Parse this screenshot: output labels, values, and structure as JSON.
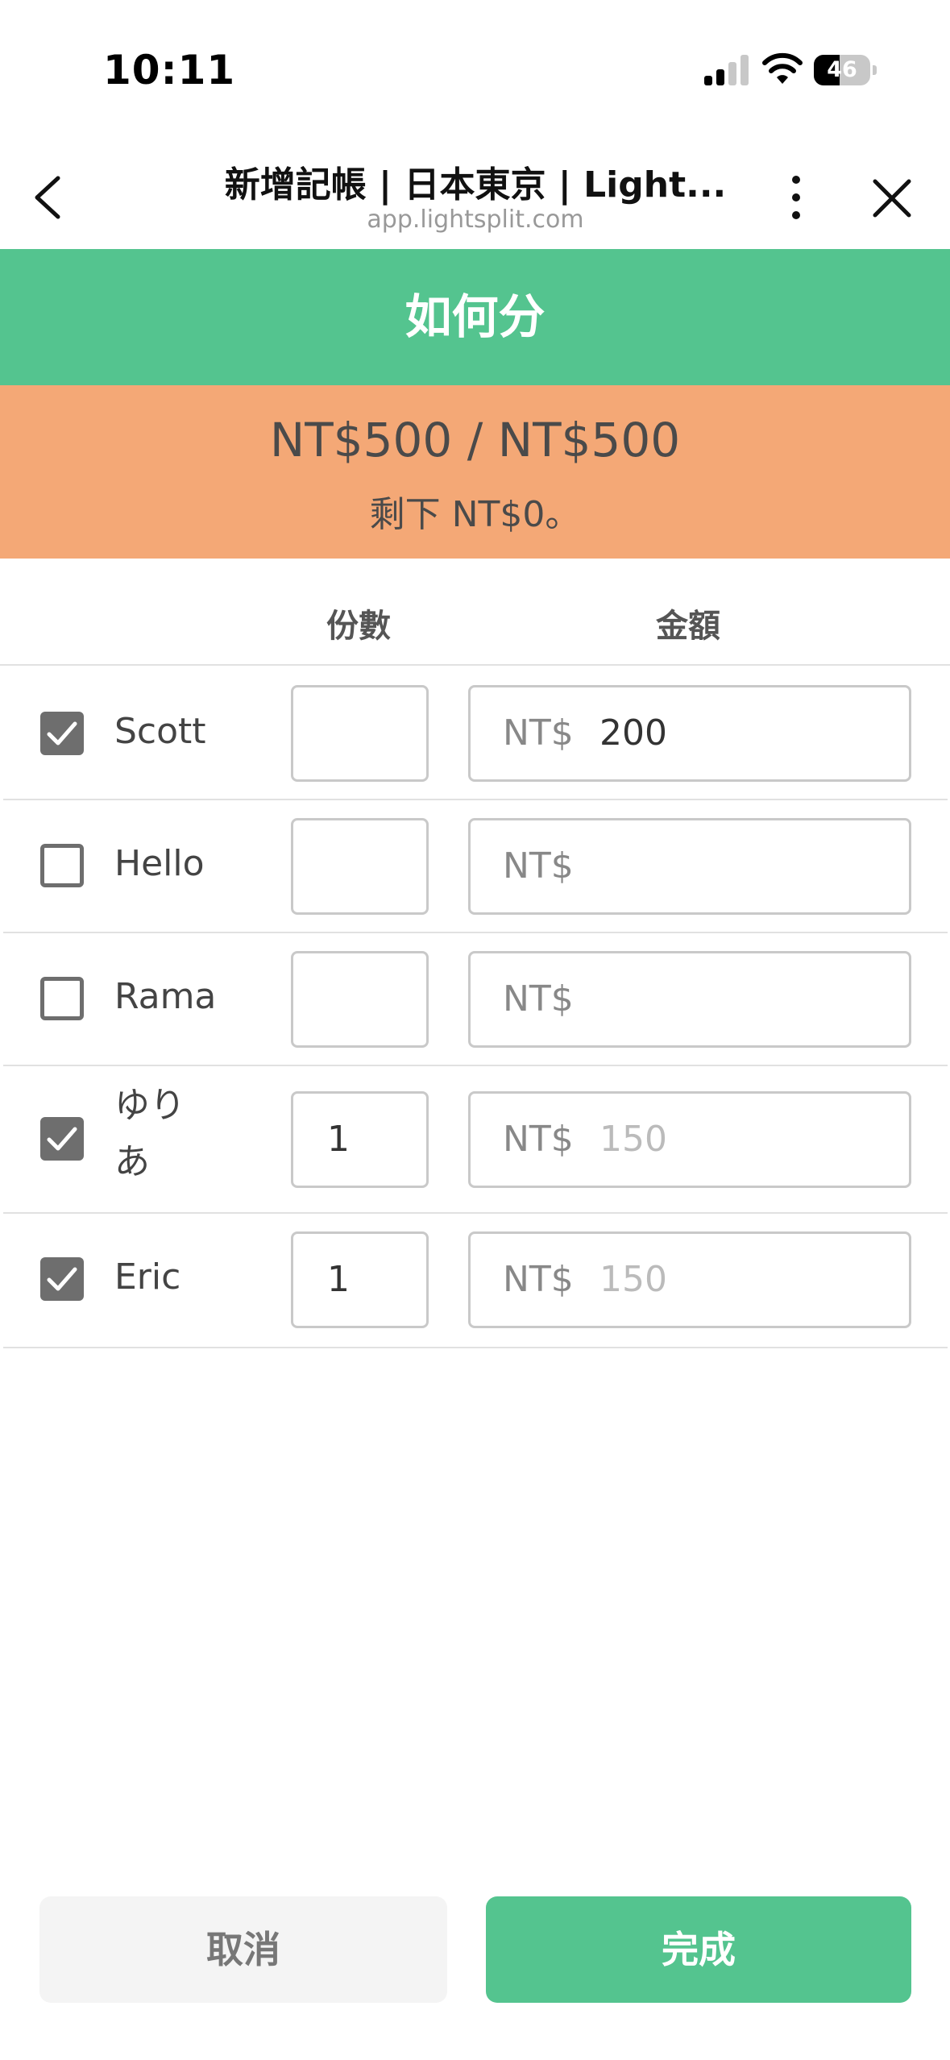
{
  "status_bar": {
    "time": "10:11",
    "battery_level": "46",
    "battery_percent": 46
  },
  "browser": {
    "title": "新增記帳 | 日本東京 | Light...",
    "url": "app.lightsplit.com",
    "icons": {
      "back": "chevron-left-icon",
      "more": "more-vertical-icon",
      "close": "close-icon"
    }
  },
  "split": {
    "header": "如何分",
    "summary": "NT$500 / NT$500",
    "remaining": "剩下 NT$0。",
    "columns": {
      "shares": "份數",
      "amount": "金額"
    },
    "rows": [
      {
        "checked": true,
        "name": "Scott",
        "shares": "",
        "currency": "NT$",
        "amount": "200",
        "amount_is_value": true
      },
      {
        "checked": false,
        "name": "Hello",
        "shares": "",
        "currency": "NT$",
        "amount": "",
        "amount_is_value": false
      },
      {
        "checked": false,
        "name": "Rama",
        "shares": "",
        "currency": "NT$",
        "amount": "",
        "amount_is_value": false
      },
      {
        "checked": true,
        "name": "ゆりあ",
        "name_line1": "ゆり",
        "name_line2": "あ",
        "shares": "1",
        "currency": "NT$",
        "amount": "150",
        "amount_is_value": false
      },
      {
        "checked": true,
        "name": "Eric",
        "shares": "1",
        "currency": "NT$",
        "amount": "150",
        "amount_is_value": false
      }
    ]
  },
  "actions": {
    "cancel": "取消",
    "done": "完成"
  },
  "colors": {
    "green": "#54c48f",
    "orange": "#f4a876",
    "checkbox": "#6e6e6e"
  }
}
